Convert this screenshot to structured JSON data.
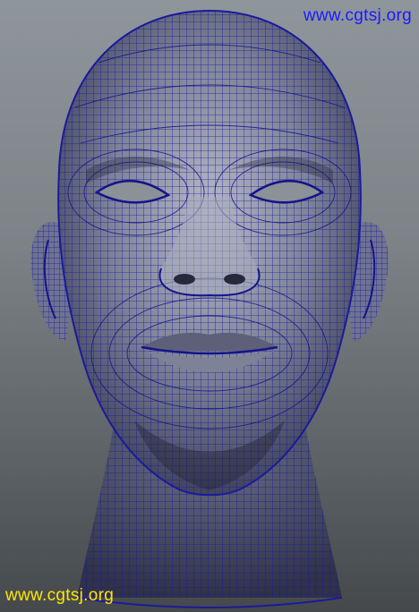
{
  "watermark": {
    "top_text": "www.cgtsj.org",
    "bottom_text": "www.cgtsj.org",
    "top_color": "#1a1aff",
    "bottom_color": "#ffe600"
  },
  "model": {
    "subject": "wireframe-head-mesh",
    "wire_color": "#1a1a9c",
    "shade_color": "#8e93a6"
  }
}
